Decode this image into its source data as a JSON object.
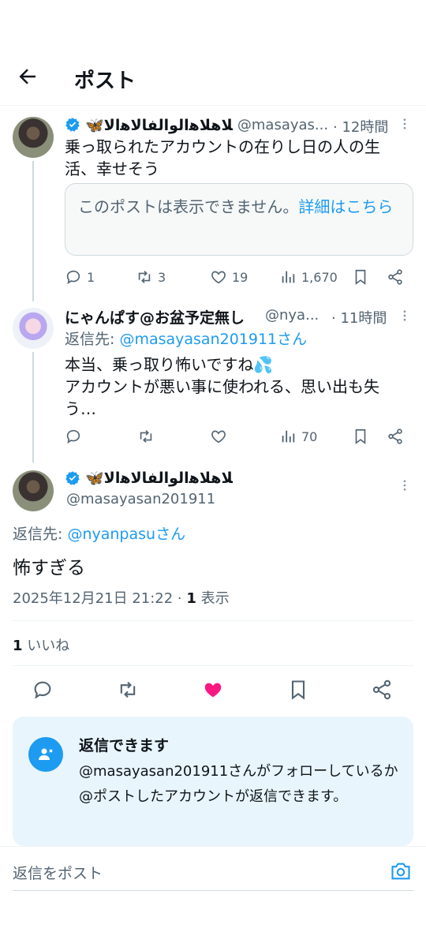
{
  "header": {
    "title": "ポスト"
  },
  "post1": {
    "display_name": "🦋ﻼﻫﻼﻫﺍﻟﻮﺍﻟﻔﺎﻟﺎﻫﺍﻟﺎ",
    "handle": "@masayas...",
    "time": "· 12時間",
    "text": "乗っ取られたアカウントの在りし日の人の生活、幸せそう",
    "quote_text": "このポストは表示できません。",
    "quote_link": "詳細はこちら",
    "stats": {
      "replies": "1",
      "reposts": "3",
      "likes": "19",
      "views": "1,670"
    }
  },
  "post2": {
    "display_name": "にゃんぱす@お盆予定無し",
    "handle": "@nya...",
    "time": "· 11時間",
    "reply_label": "返信先:",
    "reply_to": "@masayasan201911さん",
    "text": "本当、乗っ取り怖いですね💦\nアカウントが悪い事に使われる、思い出も失う…",
    "stats": {
      "views": "70"
    }
  },
  "main_post": {
    "display_name": "🦋ﻼﻫﻼﻫﺍﻟﻮﺍﻟﻔﺎﻟﺎﻫﺍﻟﺎ",
    "handle": "@masayasan201911",
    "reply_label": "返信先:",
    "reply_to": "@nyanpasuさん",
    "text": "怖すぎる",
    "timestamp": "2025年12月21日 21:22 · ",
    "views_count": "1",
    "views_label": " 表示",
    "likes_count": "1",
    "likes_label": " いいね"
  },
  "reply_notice": {
    "title": "返信できます",
    "text": "@masayasan201911さんがフォローしているか@ポストしたアカウントが返信できます。"
  },
  "composer": {
    "placeholder": "返信をポスト"
  },
  "colors": {
    "accent": "#1d9bf0",
    "like": "#f91880",
    "muted": "#536471"
  },
  "icons": [
    "back-arrow-icon",
    "verified-icon",
    "more-icon",
    "reply-icon",
    "repost-icon",
    "like-icon",
    "views-icon",
    "bookmark-icon",
    "share-icon",
    "person-icon",
    "camera-icon"
  ]
}
